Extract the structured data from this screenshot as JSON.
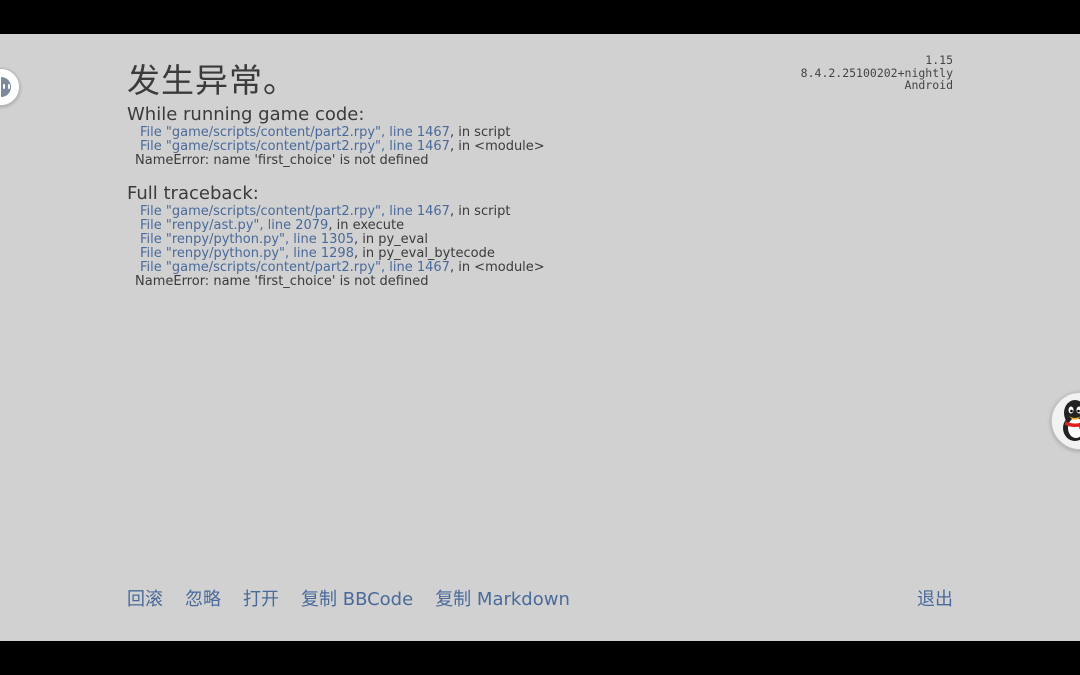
{
  "error_page": {
    "title": "发生异常。",
    "version": {
      "game": "1.15",
      "renpy": "8.4.2.25100202+nightly",
      "platform": "Android"
    },
    "running_section": {
      "heading": "While running game code:",
      "frames": [
        {
          "file": "File \"game/scripts/content/part2.rpy\", line 1467",
          "tail": ", in script"
        },
        {
          "file": "File \"game/scripts/content/part2.rpy\", line 1467",
          "tail": ", in <module>"
        }
      ],
      "error": "NameError: name 'first_choice' is not defined"
    },
    "full_section": {
      "heading": "Full traceback:",
      "frames": [
        {
          "file": "File \"game/scripts/content/part2.rpy\", line 1467",
          "tail": ", in script"
        },
        {
          "file": "File \"renpy/ast.py\", line 2079",
          "tail": ", in execute"
        },
        {
          "file": "File \"renpy/python.py\", line 1305",
          "tail": ", in py_eval"
        },
        {
          "file": "File \"renpy/python.py\", line 1298",
          "tail": ", in py_eval_bytecode"
        },
        {
          "file": "File \"game/scripts/content/part2.rpy\", line 1467",
          "tail": ", in <module>"
        }
      ],
      "error": "NameError: name 'first_choice' is not defined"
    },
    "actions": {
      "rollback": "回滚",
      "ignore": "忽略",
      "open": "打开",
      "copy_bbcode": "复制 BBCode",
      "copy_markdown": "复制 Markdown",
      "quit": "退出"
    }
  },
  "floating_widgets": {
    "left_icon": "chat-assistant-icon",
    "right_icon": "qq-penguin-icon"
  },
  "colors": {
    "background": "#d1d1d1",
    "text": "#3b3b3b",
    "link": "#4a6a9a",
    "letterbox": "#000000"
  }
}
